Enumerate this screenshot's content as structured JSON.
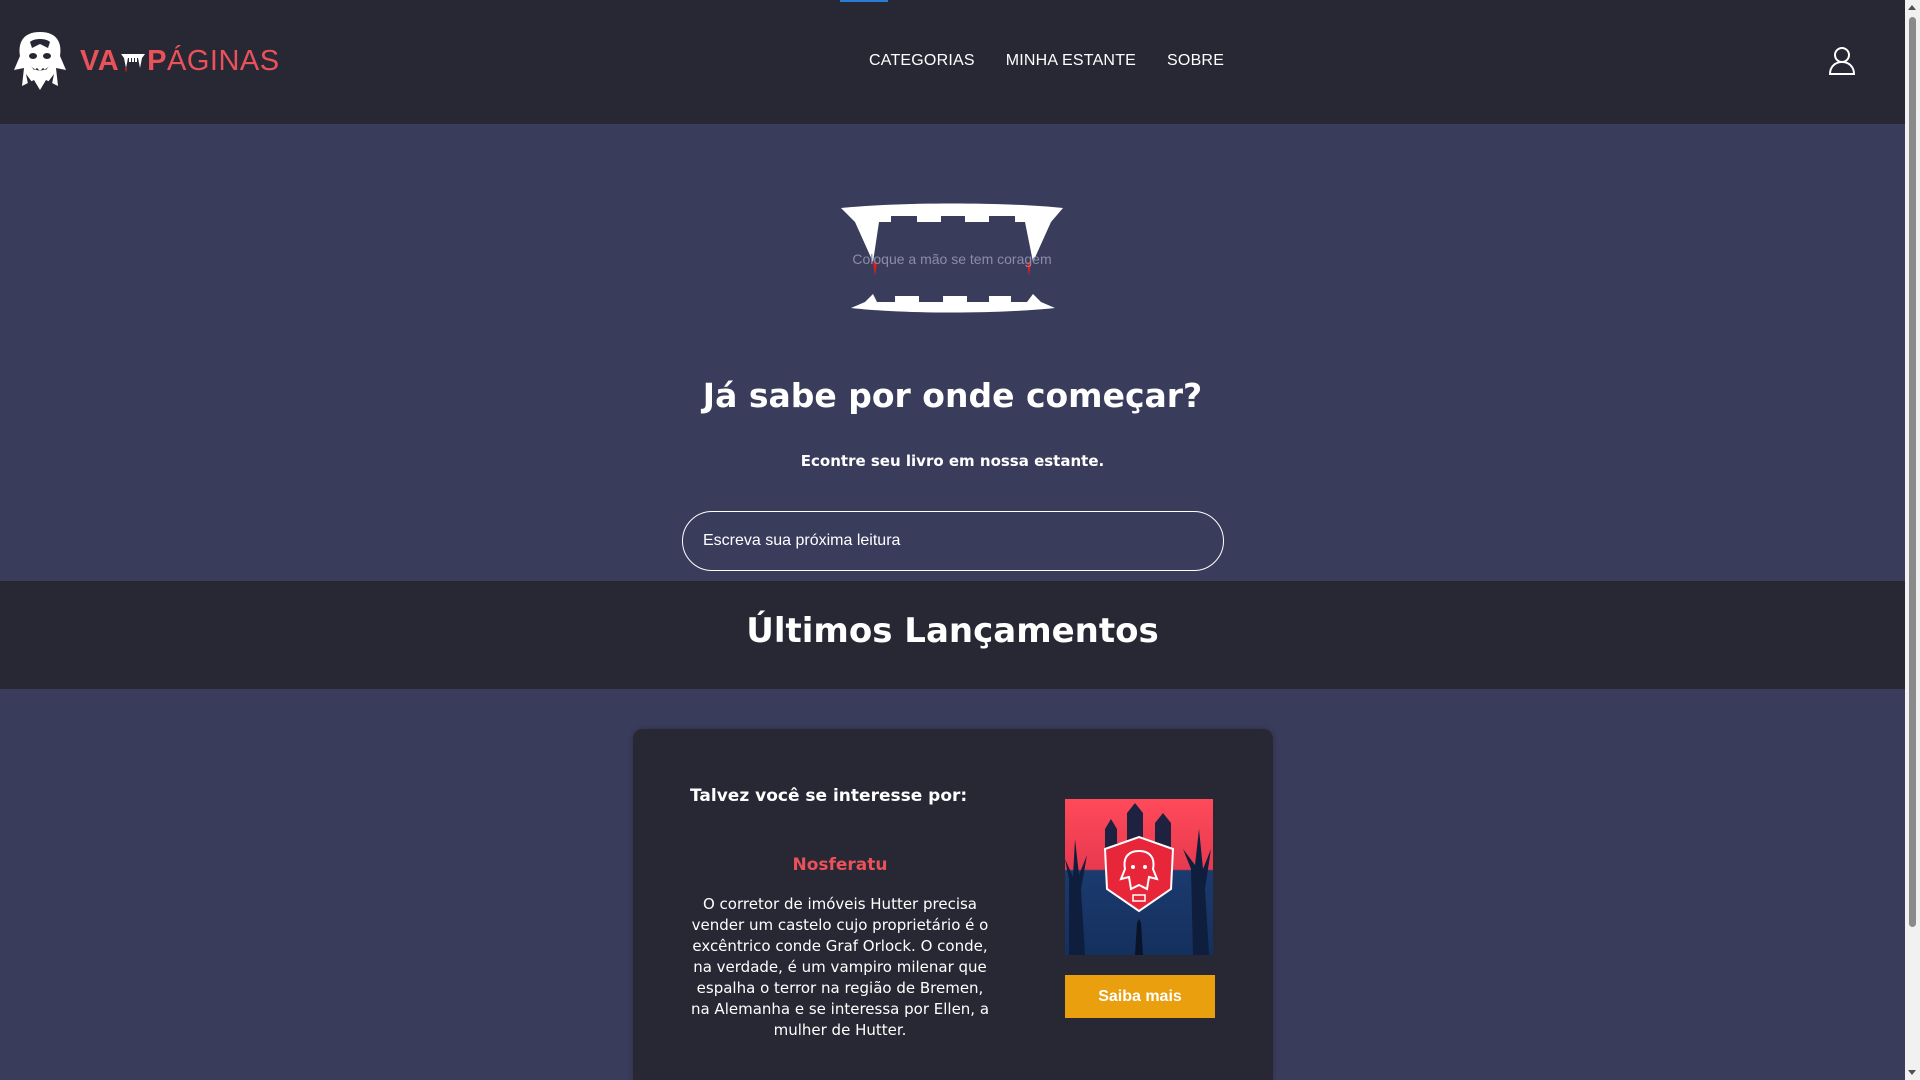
{
  "brand": {
    "prefix": "VA",
    "suffix": "PÁGINAS",
    "accent_color": "#e9525a",
    "logo_icon": "vampire-icon"
  },
  "nav": {
    "items": [
      {
        "label": "CATEGORIAS"
      },
      {
        "label": "MINHA ESTANTE"
      },
      {
        "label": "SOBRE"
      }
    ],
    "user_icon": "user-icon"
  },
  "hero": {
    "captcha_text": "Coloque a mão se tem coragem",
    "title": "Já sabe por onde começar?",
    "subtitle": "Econtre seu livro em nossa estante.",
    "search_placeholder": "Escreva sua próxima leitura"
  },
  "releases": {
    "title": "Últimos Lançamentos"
  },
  "card": {
    "heading": "Talvez você se interesse por:",
    "book_title": "Nosferatu",
    "description": "O corretor de imóveis Hutter precisa vender um castelo cujo proprietário é o excêntrico conde Graf Orlock. O conde, na verdade, é um vampiro milenar que espalha o terror na região de Bremen, na Alemanha e se interessa por Ellen, a mulher de Hutter.",
    "button_label": "Saiba mais",
    "button_color": "#ea9f0f"
  },
  "colors": {
    "header_bg": "#272834",
    "page_bg": "#3a3c5c"
  }
}
